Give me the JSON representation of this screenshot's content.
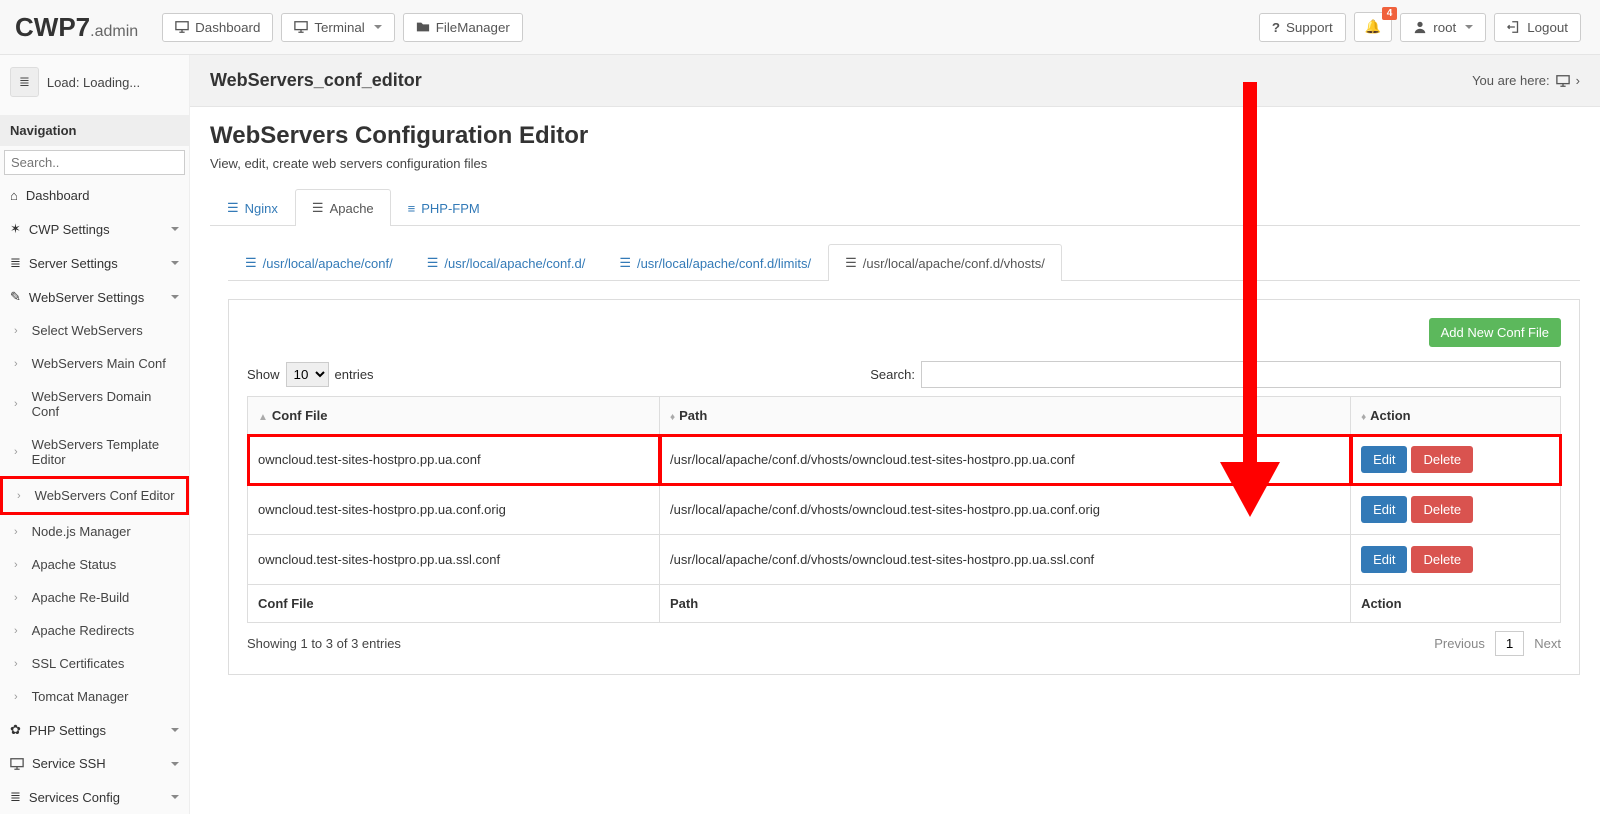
{
  "brand": {
    "name": "CWP7",
    "suffix": ".admin"
  },
  "topnav": {
    "dashboard": "Dashboard",
    "terminal": "Terminal",
    "filemanager": "FileManager",
    "support": "Support",
    "user": "root",
    "logout": "Logout",
    "notif_count": "4"
  },
  "sidebar": {
    "load": "Load: Loading...",
    "nav_header": "Navigation",
    "search_placeholder": "Search..",
    "items": [
      {
        "label": "Dashboard",
        "icon": "home",
        "expandable": false
      },
      {
        "label": "CWP Settings",
        "icon": "wrench",
        "expandable": true
      },
      {
        "label": "Server Settings",
        "icon": "server",
        "expandable": true
      },
      {
        "label": "WebServer Settings",
        "icon": "pencil",
        "expandable": true
      }
    ],
    "sub": [
      "Select WebServers",
      "WebServers Main Conf",
      "WebServers Domain Conf",
      "WebServers Template Editor",
      "WebServers Conf Editor",
      "Node.js Manager",
      "Apache Status",
      "Apache Re-Build",
      "Apache Redirects",
      "SSL Certificates",
      "Tomcat Manager"
    ],
    "after": [
      {
        "label": "PHP Settings",
        "icon": "gear"
      },
      {
        "label": "Service SSH",
        "icon": "monitor"
      },
      {
        "label": "Services Config",
        "icon": "server"
      }
    ]
  },
  "titlebar": {
    "title": "WebServers_conf_editor",
    "breadcrumb": "You are here:"
  },
  "page": {
    "heading": "WebServers Configuration Editor",
    "desc": "View, edit, create web servers configuration files"
  },
  "tabs": {
    "t0": "Nginx",
    "t1": "Apache",
    "t2": "PHP-FPM",
    "active": 1
  },
  "subtabs": {
    "t0": "/usr/local/apache/conf/",
    "t1": "/usr/local/apache/conf.d/",
    "t2": "/usr/local/apache/conf.d/limits/",
    "t3": "/usr/local/apache/conf.d/vhosts/",
    "active": 3
  },
  "panel": {
    "add": "Add New Conf File",
    "show": "Show",
    "entries": "entries",
    "search": "Search:",
    "select_value": "10"
  },
  "table": {
    "th_conf": "Conf File",
    "th_path": "Path",
    "th_action": "Action",
    "rows": [
      {
        "conf": "owncloud.test-sites-hostpro.pp.ua.conf",
        "path": "/usr/local/apache/conf.d/vhosts/owncloud.test-sites-hostpro.pp.ua.conf",
        "highlight": true
      },
      {
        "conf": "owncloud.test-sites-hostpro.pp.ua.conf.orig",
        "path": "/usr/local/apache/conf.d/vhosts/owncloud.test-sites-hostpro.pp.ua.conf.orig",
        "highlight": false
      },
      {
        "conf": "owncloud.test-sites-hostpro.pp.ua.ssl.conf",
        "path": "/usr/local/apache/conf.d/vhosts/owncloud.test-sites-hostpro.pp.ua.ssl.conf",
        "highlight": false
      }
    ],
    "edit": "Edit",
    "delete": "Delete",
    "info": "Showing 1 to 3 of 3 entries",
    "prev": "Previous",
    "page": "1",
    "next": "Next"
  }
}
